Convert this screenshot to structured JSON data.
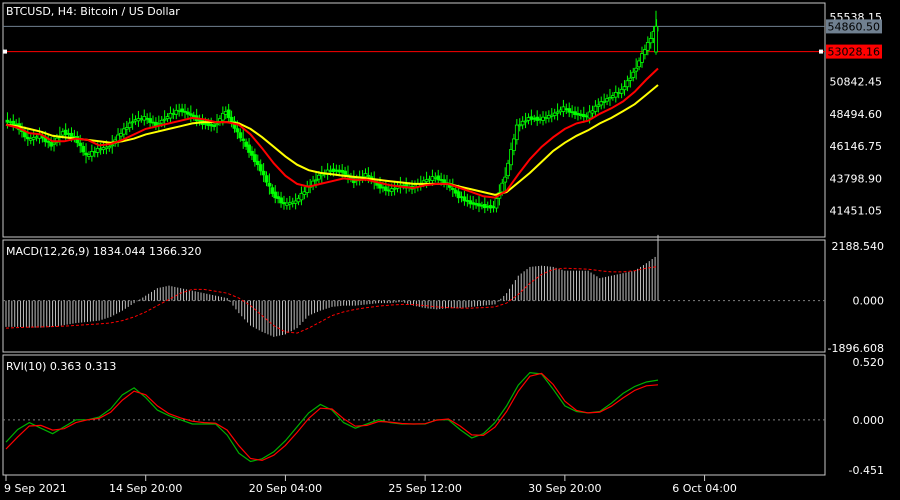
{
  "theme": {
    "background": "#000000",
    "frame": "#c8c8c8",
    "text": "#ffffff",
    "bull": "#00ff00",
    "bear": "#00ff00",
    "ma_fast": "#ff0000",
    "ma_slow": "#ffff00",
    "resistance": "#ff0000",
    "current_badge": "#708090",
    "support_badge": "#ff0000",
    "macd_hist": "#c0c0c0",
    "macd_signal": "#ff0000",
    "rvi_main": "#00b000",
    "rvi_signal": "#ff0000",
    "zero_line": "#808080"
  },
  "chart_data": [
    {
      "type": "candlestick",
      "title": "BTCUSD, H4:  Bitcoin / US Dollar",
      "ylim": [
        39900,
        56200
      ],
      "yticks": [
        "55538.15",
        "50842.45",
        "48494.60",
        "46146.75",
        "43798.90",
        "41451.05"
      ],
      "current_price": "54860.50",
      "horizontal_line": "53028.16",
      "price_series": [
        48000,
        47700,
        46600,
        46900,
        46200,
        47200,
        46800,
        45400,
        45900,
        46100,
        47100,
        48000,
        48200,
        47700,
        48300,
        48800,
        48400,
        47800,
        47600,
        48700,
        47100,
        45800,
        44400,
        42700,
        41900,
        42100,
        43100,
        44000,
        44400,
        44300,
        43600,
        44100,
        43300,
        42900,
        43300,
        43100,
        43600,
        43900,
        43400,
        42500,
        42000,
        41800,
        41700,
        44000,
        47600,
        48200,
        48100,
        48400,
        48900,
        48500,
        48300,
        49200,
        49700,
        50200,
        51500,
        53200,
        54860
      ],
      "ma_fast": [
        47700,
        47500,
        47100,
        47000,
        46500,
        46500,
        46700,
        46600,
        46200,
        46300,
        46600,
        47000,
        47400,
        47600,
        47800,
        48000,
        48200,
        48100,
        47900,
        47900,
        47700,
        47000,
        46000,
        44900,
        44000,
        43400,
        43200,
        43400,
        43600,
        43800,
        43700,
        43700,
        43500,
        43300,
        43200,
        43100,
        43300,
        43400,
        43400,
        43100,
        42800,
        42500,
        42400,
        42900,
        44100,
        45200,
        46100,
        46800,
        47400,
        47800,
        48000,
        48500,
        48900,
        49400,
        50100,
        51000,
        51800
      ],
      "ma_slow": [
        47700,
        47600,
        47400,
        47200,
        46900,
        46800,
        46700,
        46600,
        46500,
        46400,
        46500,
        46700,
        47000,
        47200,
        47400,
        47600,
        47800,
        47900,
        47900,
        47900,
        47800,
        47400,
        46800,
        46100,
        45400,
        44800,
        44400,
        44200,
        44100,
        44000,
        43900,
        43800,
        43700,
        43600,
        43500,
        43400,
        43400,
        43400,
        43400,
        43200,
        43000,
        42800,
        42600,
        42800,
        43500,
        44200,
        45000,
        45800,
        46400,
        46900,
        47300,
        47800,
        48200,
        48700,
        49200,
        49900,
        50600
      ]
    },
    {
      "type": "histogram",
      "title": "MACD(12,26,9) 1834.044 1366.320",
      "ylim": [
        -1896.608,
        2188.54
      ],
      "yticks": [
        "2188.540",
        "0.000",
        "-1896.608"
      ],
      "histogram": [
        -1050,
        -1050,
        -1080,
        -1080,
        -1050,
        -980,
        -900,
        -850,
        -800,
        -650,
        -400,
        -100,
        200,
        500,
        600,
        500,
        400,
        300,
        200,
        100,
        -500,
        -1000,
        -1250,
        -1450,
        -1350,
        -1100,
        -600,
        -400,
        -250,
        -200,
        -200,
        -150,
        -100,
        -100,
        -50,
        -200,
        -300,
        -350,
        -300,
        -300,
        -250,
        -200,
        -150,
        300,
        1000,
        1350,
        1400,
        1350,
        1200,
        1200,
        1200,
        900,
        1000,
        1100,
        1200,
        1500,
        1834
      ],
      "signal": [
        -1100,
        -1080,
        -1060,
        -1050,
        -1040,
        -1020,
        -990,
        -960,
        -930,
        -890,
        -800,
        -650,
        -450,
        -200,
        50,
        300,
        450,
        450,
        380,
        300,
        100,
        -200,
        -600,
        -1000,
        -1250,
        -1300,
        -1100,
        -850,
        -600,
        -450,
        -350,
        -280,
        -220,
        -180,
        -150,
        -160,
        -200,
        -250,
        -280,
        -300,
        -300,
        -280,
        -250,
        -100,
        250,
        700,
        1050,
        1250,
        1300,
        1280,
        1260,
        1200,
        1150,
        1150,
        1200,
        1300,
        1366
      ]
    },
    {
      "type": "line",
      "title": "RVI(10) 0.363 0.313",
      "ylim": [
        -0.451,
        0.52
      ],
      "yticks": [
        "0.520",
        "0.000",
        "-0.451"
      ],
      "main": [
        -0.25,
        -0.05,
        0.0,
        -0.05,
        -0.2,
        -0.05,
        0.05,
        -0.05,
        0.05,
        0.05,
        0.25,
        0.35,
        0.2,
        0.05,
        0.05,
        0.0,
        -0.05,
        -0.05,
        0.0,
        -0.1,
        -0.35,
        -0.4,
        -0.35,
        -0.3,
        -0.2,
        -0.05,
        0.05,
        0.2,
        0.1,
        -0.05,
        -0.1,
        -0.05,
        0.05,
        -0.05,
        -0.05,
        0.0,
        -0.1,
        0.05,
        0.0,
        -0.05,
        -0.25,
        -0.1,
        -0.05,
        0.1,
        0.35,
        0.45,
        0.45,
        0.3,
        0.05,
        0.1,
        0.05,
        0.05,
        0.15,
        0.25,
        0.3,
        0.35,
        0.36
      ],
      "signal": [
        -0.3,
        -0.15,
        -0.02,
        -0.03,
        -0.12,
        -0.1,
        0.0,
        0.0,
        0.0,
        0.05,
        0.18,
        0.3,
        0.25,
        0.1,
        0.05,
        0.02,
        -0.02,
        -0.03,
        -0.02,
        -0.05,
        -0.25,
        -0.38,
        -0.38,
        -0.32,
        -0.25,
        -0.1,
        0.0,
        0.15,
        0.12,
        0.0,
        -0.08,
        -0.07,
        0.02,
        -0.03,
        -0.04,
        -0.02,
        -0.07,
        0.02,
        0.02,
        -0.03,
        -0.18,
        -0.15,
        -0.08,
        0.05,
        0.28,
        0.42,
        0.45,
        0.35,
        0.12,
        0.08,
        0.06,
        0.05,
        0.12,
        0.2,
        0.27,
        0.32,
        0.313
      ]
    }
  ],
  "xaxis": {
    "labels": [
      "9 Sep 2021",
      "14 Sep 20:00",
      "20 Sep 04:00",
      "25 Sep 12:00",
      "30 Sep 20:00",
      "6 Oct 04:00"
    ],
    "label_index": [
      0,
      12,
      24,
      36,
      48,
      60
    ],
    "count": 57
  }
}
